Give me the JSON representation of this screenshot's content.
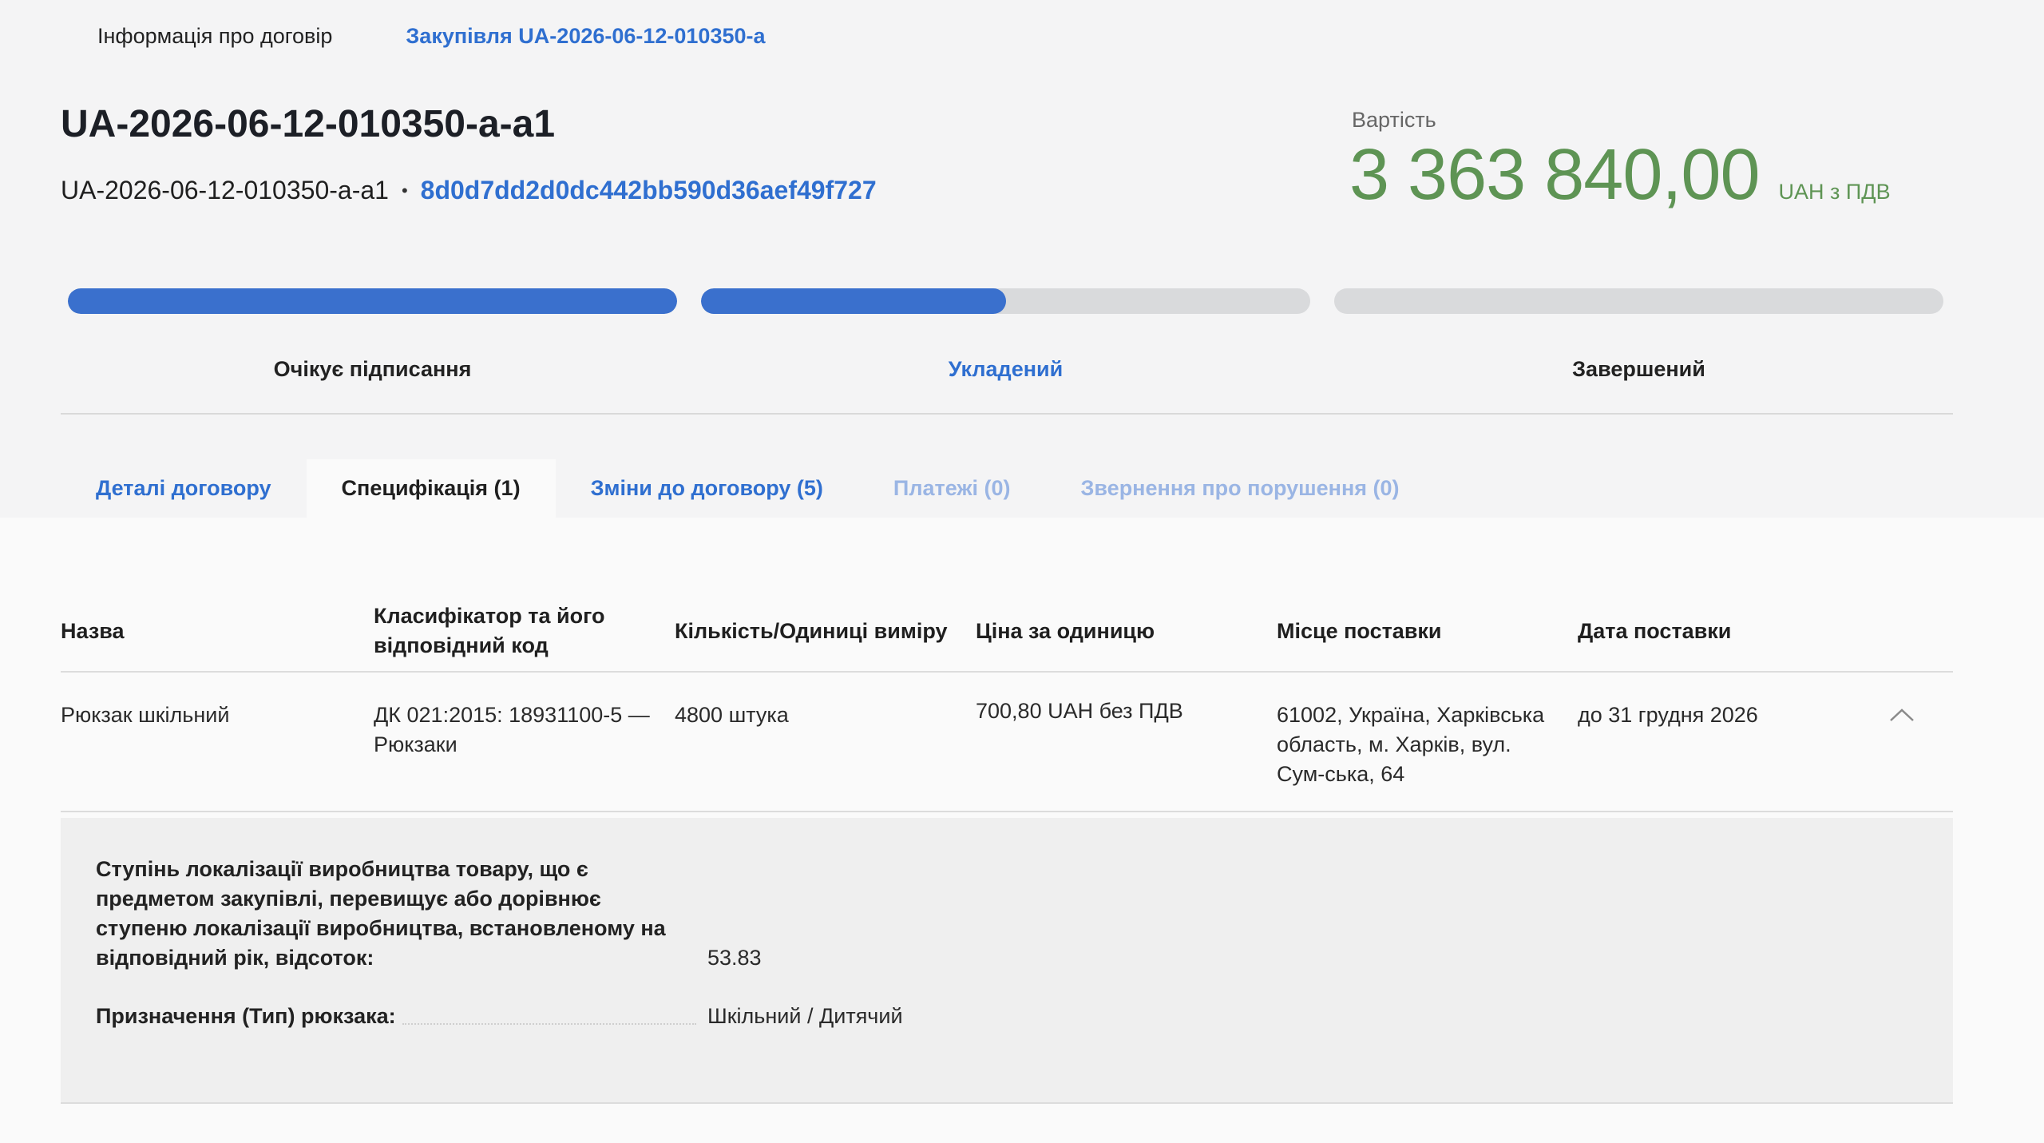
{
  "breadcrumbs": {
    "info": "Інформація про договір",
    "procurement": "Закупівля UA-2026-06-12-010350-a"
  },
  "contract": {
    "title": "UA-2026-06-12-010350-a-a1",
    "id": "UA-2026-06-12-010350-a-a1",
    "separator": "•",
    "hash": "8d0d7dd2d0dc442bb590d36aef49f727"
  },
  "cost": {
    "label": "Вартість",
    "value": "3 363 840,00",
    "currency": "UAH з ПДВ",
    "color": "#5e9454"
  },
  "stepper": [
    {
      "label": "Очікує підписання",
      "progress": 1.0,
      "active": false
    },
    {
      "label": "Укладений",
      "progress": 0.5,
      "active": true
    },
    {
      "label": "Завершений",
      "progress": 0.0,
      "active": false
    }
  ],
  "accent": "#2f6fd0",
  "tabs": [
    {
      "label": "Деталі договору",
      "state": "link"
    },
    {
      "label": "Специфікація (1)",
      "state": "active"
    },
    {
      "label": "Зміни до договору (5)",
      "state": "link"
    },
    {
      "label": "Платежі (0)",
      "state": "disabled"
    },
    {
      "label": "Звернення про порушення (0)",
      "state": "disabled"
    }
  ],
  "table": {
    "headers": [
      "Назва",
      "Класифікатор та його відповідний код",
      "Кількість/Одиниці виміру",
      "Ціна за одиницю",
      "Місце поставки",
      "Дата поставки"
    ],
    "rows": [
      [
        "Рюкзак шкільний",
        "ДК 021:2015: 18931100-5 — Рюкзаки",
        "4800 штука",
        "700,80 UAH без ПДВ",
        "61002, Україна, Харківська область, м. Харків, вул. Сум-ська, 64",
        "до 31 грудня 2026"
      ]
    ],
    "expand_icon": "chevron-up-icon"
  },
  "details": [
    {
      "label": "Ступінь локалізації виробництва товару, що є предметом закупівлі, перевищує або дорівнює ступеню локалізації виробництва, встановленому на відповідний рік, відсоток:",
      "value": "53.83"
    },
    {
      "label": "Призначення (Тип) рюкзака:",
      "value": "Шкільний / Дитячий"
    }
  ]
}
